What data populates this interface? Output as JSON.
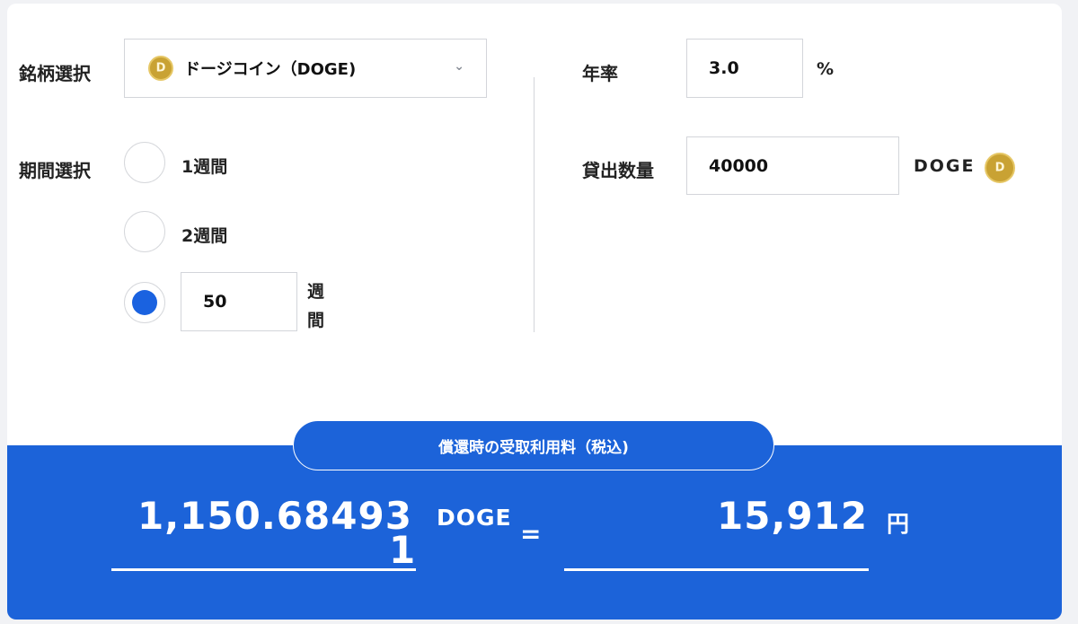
{
  "coin": {
    "label": "銘柄選択",
    "selected": "ドージコイン（DOGE)",
    "icon": "doge-coin-icon"
  },
  "rate": {
    "label": "年率",
    "value": "3.0",
    "unit": "%"
  },
  "period": {
    "label": "期間選択",
    "options": [
      "1週間",
      "2週間"
    ],
    "custom_value": "50",
    "custom_unit_line1": "週",
    "custom_unit_line2": "間",
    "selected": "custom"
  },
  "amount": {
    "label": "貸出数量",
    "value": "40000",
    "unit": "DOGE"
  },
  "result": {
    "title": "償還時の受取利用料（税込)",
    "doge_value_main": "1,150.68493",
    "doge_value_overflow": "1",
    "doge_unit": "DOGE",
    "equals": "=",
    "yen_value": "15,912",
    "yen_unit": "円"
  },
  "colors": {
    "accent": "#1c63d9",
    "radio_checked": "#1a62e0",
    "coin_gold": "#c9a233"
  }
}
